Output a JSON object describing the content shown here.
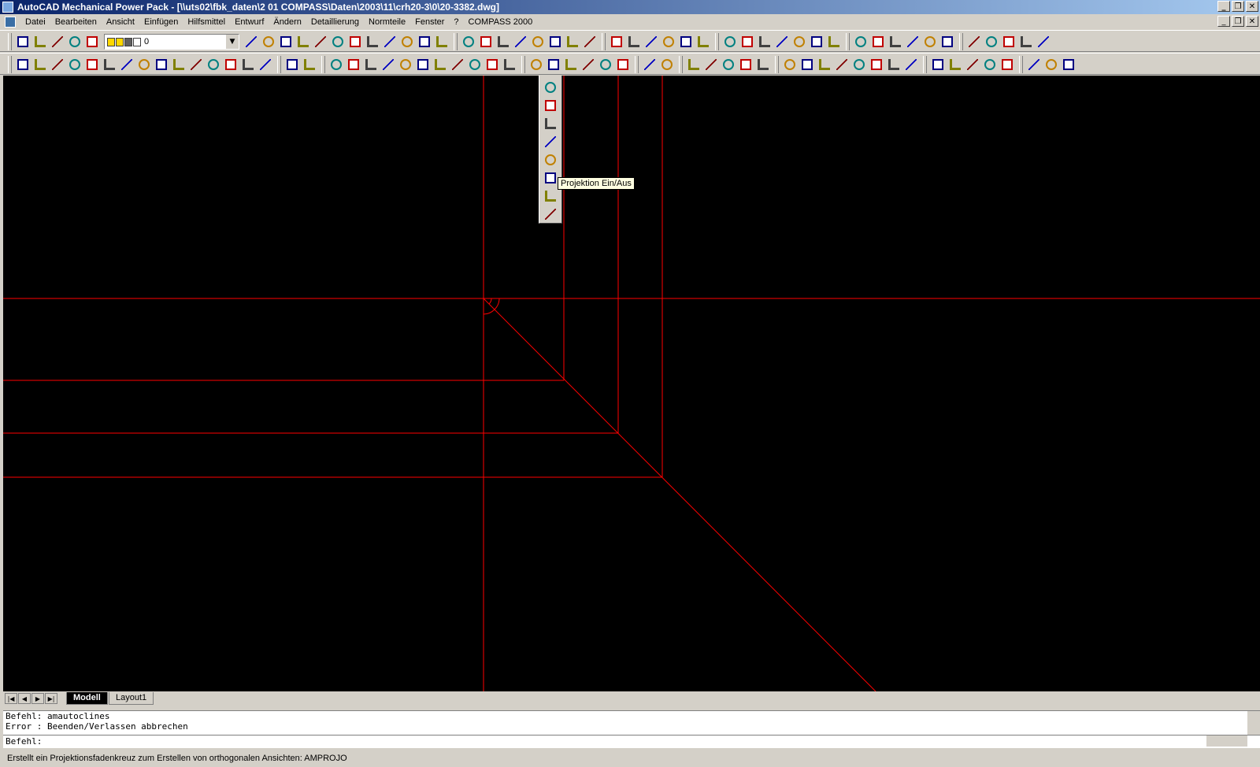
{
  "window": {
    "title": "AutoCAD Mechanical Power Pack - [\\\\uts02\\fbk_daten\\2 01 COMPASS\\Daten\\2003\\11\\crh20-3\\0\\20-3382.dwg]",
    "buttons": {
      "minimize": "_",
      "restore": "❐",
      "close": "✕"
    }
  },
  "menu": {
    "items": [
      "Datei",
      "Bearbeiten",
      "Ansicht",
      "Einfügen",
      "Hilfsmittel",
      "Entwurf",
      "Ändern",
      "Detaillierung",
      "Normteile",
      "Fenster",
      "?",
      "COMPASS 2000"
    ]
  },
  "toolbar": {
    "layer_value": "0",
    "layer_dropdown_arrow": "▼"
  },
  "flyout": {
    "tooltip": "Projektion Ein/Aus"
  },
  "tabs": {
    "nav": [
      "|◀",
      "◀",
      "▶",
      "▶|"
    ],
    "items": [
      {
        "label": "Modell",
        "active": true
      },
      {
        "label": "Layout1",
        "active": false
      }
    ]
  },
  "command": {
    "lines": [
      "Befehl: amautoclines",
      "Error : Beenden/Verlassen abbrechen"
    ],
    "prompt": "Befehl:"
  },
  "status": {
    "text": "Erstellt ein Projektionsfadenkreuz zum Erstellen von orthogonalen Ansichten: AMPROJO"
  },
  "colors": {
    "drawing_bg": "#000000",
    "line": "#ff0000",
    "titlebar_start": "#0a246a",
    "titlebar_end": "#a6caf0",
    "chrome": "#d4d0c8",
    "tooltip_bg": "#ffffe1"
  },
  "icons": {
    "row1": [
      "new-icon",
      "open-icon",
      "save-icon",
      "plot-icon",
      "layers-icon",
      "|layer|",
      "undo-icon",
      "properties-icon",
      "design-center-icon",
      "tool-palette-icon",
      "db-connect-icon",
      "table-icon",
      "zoom-icon",
      "pan-icon",
      "redraw-icon",
      "regen-icon",
      "ucs-icon",
      "dist-icon",
      "|",
      "autocad-logo-icon",
      "dot-icon",
      "text-style-icon",
      "viewport-icon",
      "hatch-icon",
      "cal-icon",
      "help-icon",
      "user-icon",
      "|",
      "layer-manager-icon",
      "find-icon",
      "delete-icon",
      "block-icon",
      "audit-icon",
      "purge-icon",
      "|",
      "preview-icon",
      "print-icon",
      "undo-arrow-icon",
      "redo-arrow-icon",
      "zoom-realtime-icon",
      "zoom-window-icon",
      "plus-icon",
      "|",
      "centerline-icon",
      "m-icon",
      "copy-icon",
      "u-icon",
      "dim-icon",
      "balloon-icon",
      "|",
      "measure-icon",
      "brush-icon",
      "scale-icon",
      "smiley-icon",
      "book-icon"
    ],
    "row2": [
      "edit-icon",
      "rotate-icon",
      "move-icon",
      "stretch-icon",
      "array-icon",
      "mirror-icon",
      "offset-icon",
      "trim-icon",
      "extend-icon",
      "break-icon",
      "circle-icon",
      "rectangle-icon",
      "fillet-icon",
      "chamfer-icon",
      "corner-icon",
      "|",
      "copy-clip-icon",
      "return-icon",
      "|",
      "line-icon",
      "arc-icon",
      "spline-icon",
      "rect-icon",
      "polygon-icon",
      "clock-icon",
      "gradient-icon",
      "hatch-red-icon",
      "construction-icon",
      "projection-icon",
      "frame-icon",
      "|",
      "sheet-icon",
      "scale-bar-icon",
      "hole-icon",
      "download-icon",
      "grid-icon",
      "color-icon",
      "|",
      "insert-icon",
      "leader-icon",
      "|",
      "layout-icon",
      "group-icon",
      "window-icon",
      "text-a-icon",
      "mtext-icon",
      "|",
      "surface-icon",
      "symbol-icon",
      "weld-icon",
      "datum-icon",
      "pin-icon",
      "curve-icon",
      "triangle-icon",
      "note-icon",
      "|",
      "edit-dim-icon",
      "edit-note-icon",
      "search-icon",
      "bom-icon",
      "parts-icon",
      "|",
      "database-icon",
      "export-icon",
      "globe-icon"
    ],
    "flyout": [
      "construction-icon",
      "offset-line-icon",
      "parallel-line-icon",
      "angle-line-icon",
      "projection-line-icon",
      "projection-toggle-icon",
      "intersect-line-icon",
      "bisect-line-icon"
    ]
  }
}
